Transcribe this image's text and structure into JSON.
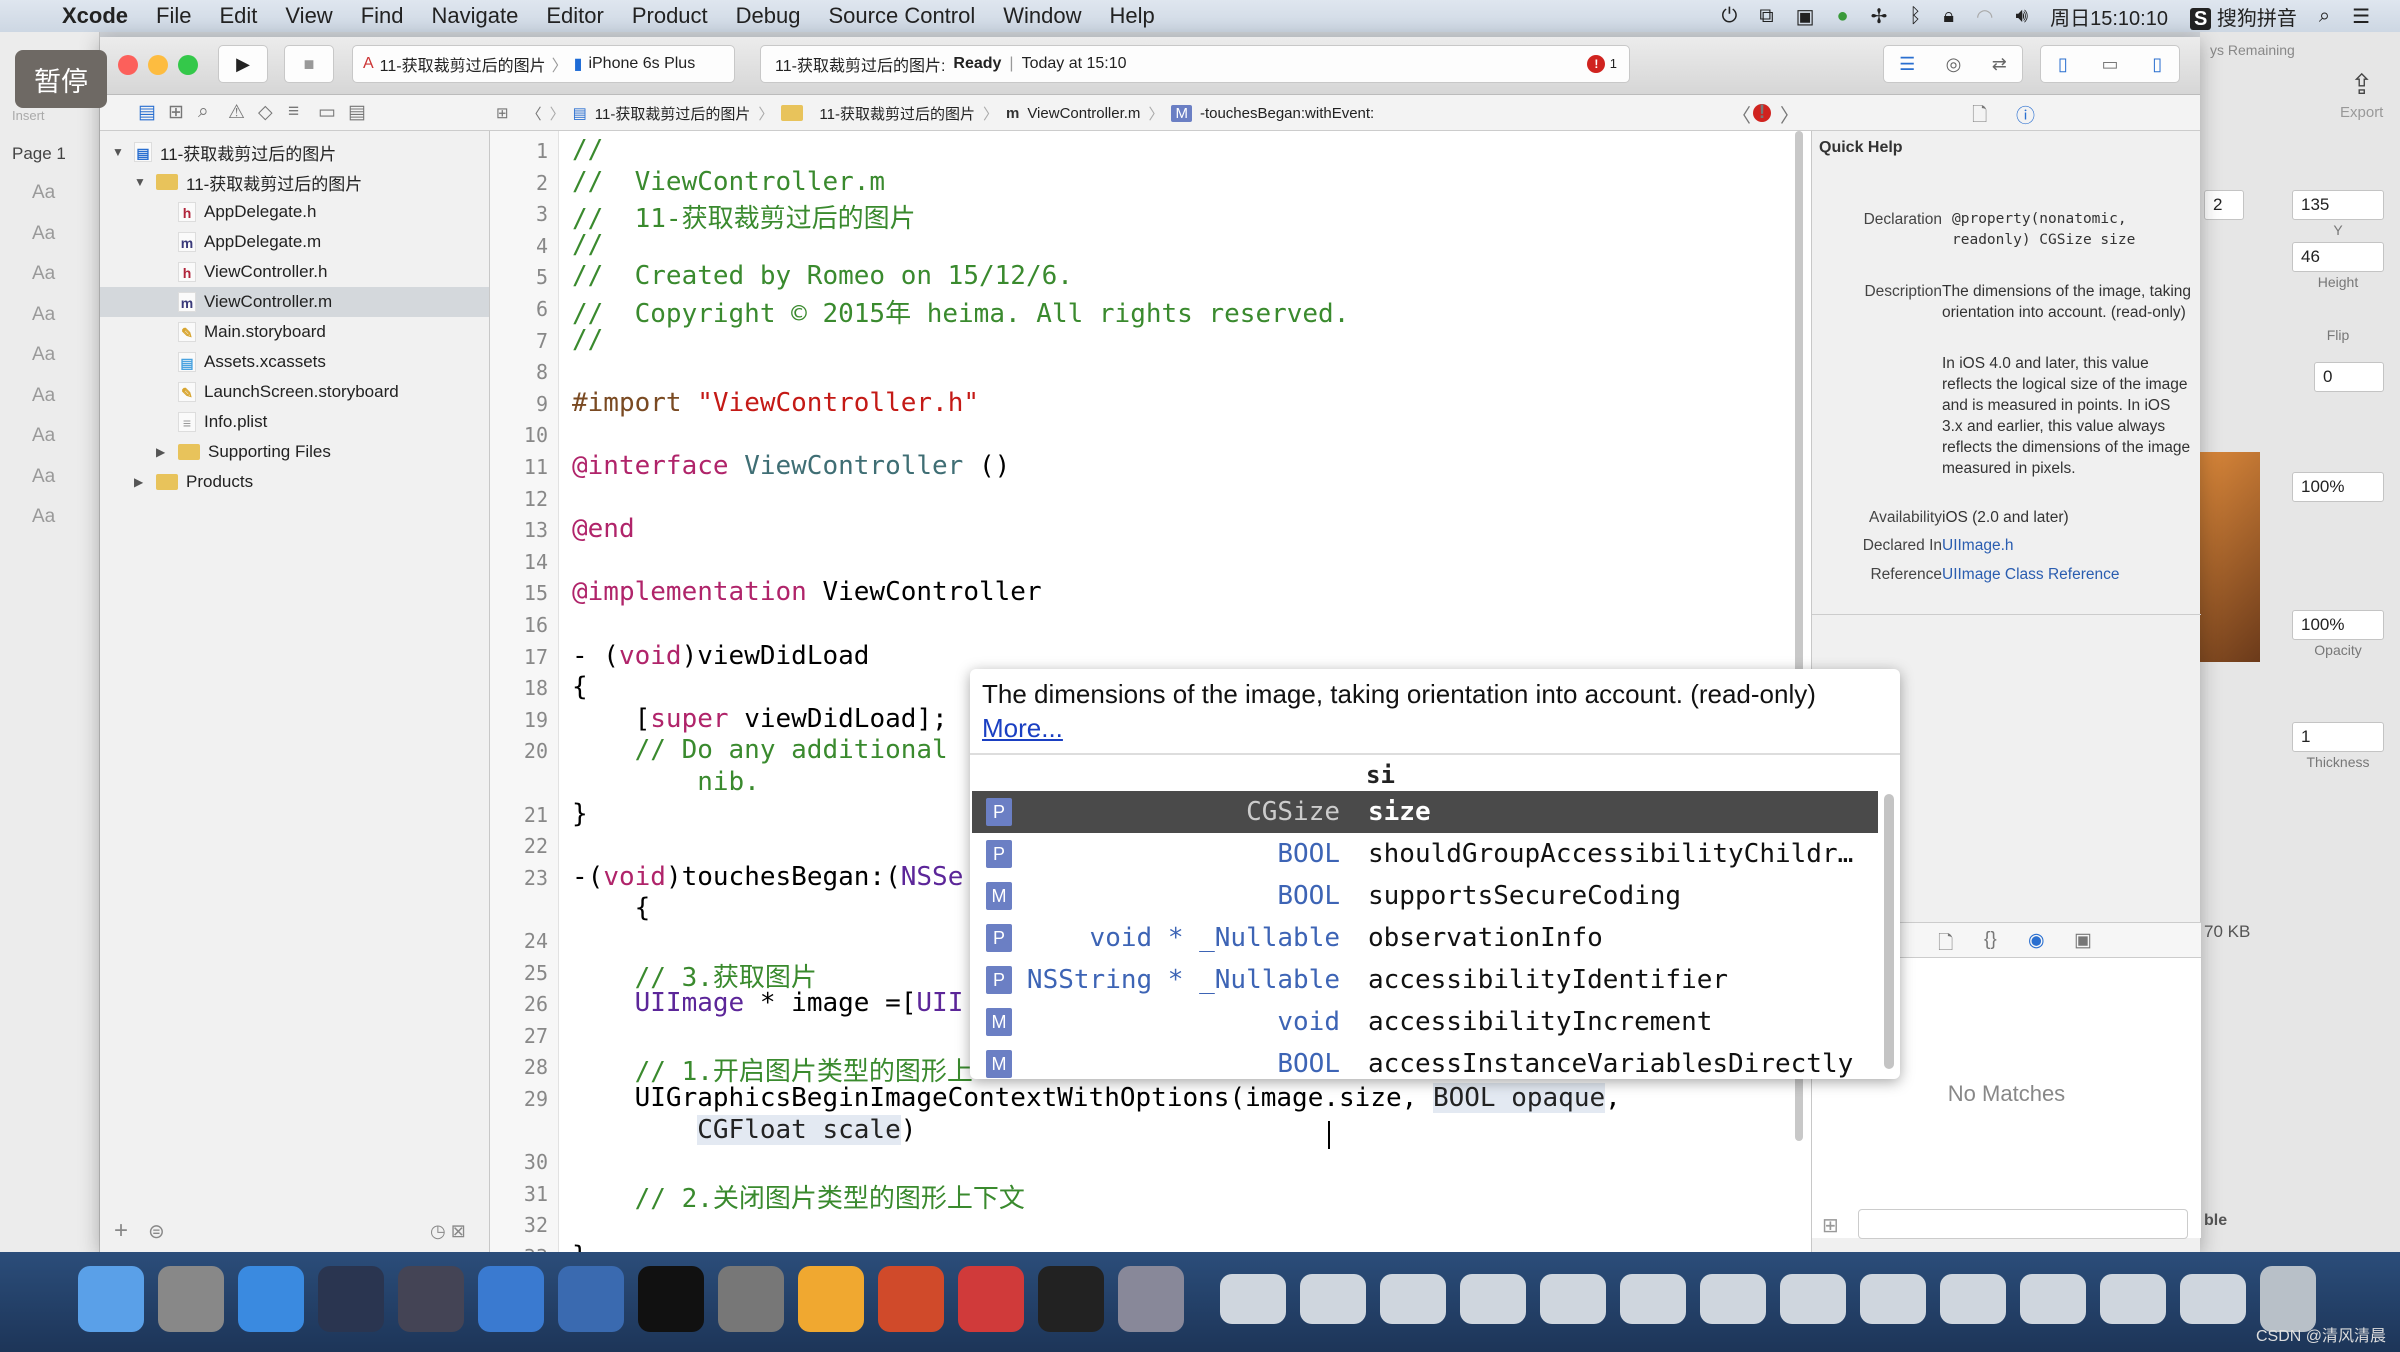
{
  "menubar": {
    "app": "Xcode",
    "items": [
      "File",
      "Edit",
      "View",
      "Find",
      "Navigate",
      "Editor",
      "Product",
      "Debug",
      "Source Control",
      "Window",
      "Help"
    ],
    "clock": "周日15:10:10",
    "ime": "搜狗拼音"
  },
  "overlay": {
    "pause": "暂停"
  },
  "toolbar": {
    "scheme": "11-获取裁剪过后的图片",
    "device": "iPhone 6s Plus",
    "status_project": "11-获取裁剪过后的图片:",
    "status_state": "Ready",
    "status_time": "Today at 15:10",
    "error_count": "1"
  },
  "jumpbar": [
    "11-获取裁剪过后的图片",
    "11-获取裁剪过后的图片",
    "ViewController.m",
    "-touchesBegan:withEvent:"
  ],
  "navigator": {
    "items": [
      {
        "label": "11-获取裁剪过后的图片",
        "icon": "project",
        "level": 0,
        "disc": "▼"
      },
      {
        "label": "11-获取裁剪过后的图片",
        "icon": "folder",
        "level": 1,
        "disc": "▼"
      },
      {
        "label": "AppDelegate.h",
        "icon": "h",
        "level": 2
      },
      {
        "label": "AppDelegate.m",
        "icon": "m",
        "level": 2
      },
      {
        "label": "ViewController.h",
        "icon": "h",
        "level": 2
      },
      {
        "label": "ViewController.m",
        "icon": "m",
        "level": 2,
        "selected": true
      },
      {
        "label": "Main.storyboard",
        "icon": "storyboard",
        "level": 2
      },
      {
        "label": "Assets.xcassets",
        "icon": "assets",
        "level": 2
      },
      {
        "label": "LaunchScreen.storyboard",
        "icon": "storyboard",
        "level": 2
      },
      {
        "label": "Info.plist",
        "icon": "plist",
        "level": 2
      },
      {
        "label": "Supporting Files",
        "icon": "folder",
        "level": 2,
        "disc": "▶"
      },
      {
        "label": "Products",
        "icon": "folder",
        "level": 1,
        "disc": "▶"
      }
    ]
  },
  "code": [
    {
      "n": "1",
      "s": [
        [
          "//",
          "com"
        ]
      ]
    },
    {
      "n": "2",
      "s": [
        [
          "//  ViewController.m",
          "com"
        ]
      ]
    },
    {
      "n": "3",
      "s": [
        [
          "//  11-获取裁剪过后的图片",
          "com"
        ]
      ]
    },
    {
      "n": "4",
      "s": [
        [
          "//",
          "com"
        ]
      ]
    },
    {
      "n": "5",
      "s": [
        [
          "//  Created by Romeo on 15/12/6.",
          "com"
        ]
      ]
    },
    {
      "n": "6",
      "s": [
        [
          "//  Copyright © 2015年 heima. All rights reserved.",
          "com"
        ]
      ]
    },
    {
      "n": "7",
      "s": [
        [
          "//",
          "com"
        ]
      ]
    },
    {
      "n": "8",
      "s": []
    },
    {
      "n": "9",
      "s": [
        [
          "#import ",
          "pp"
        ],
        [
          "\"ViewController.h\"",
          "str"
        ]
      ]
    },
    {
      "n": "10",
      "s": []
    },
    {
      "n": "11",
      "s": [
        [
          "@interface ",
          "kw"
        ],
        [
          "ViewController",
          "cls"
        ],
        [
          " ()",
          ""
        ]
      ]
    },
    {
      "n": "12",
      "s": []
    },
    {
      "n": "13",
      "s": [
        [
          "@end",
          "kw"
        ]
      ]
    },
    {
      "n": "14",
      "s": []
    },
    {
      "n": "15",
      "s": [
        [
          "@implementation ",
          "kw"
        ],
        [
          "ViewController",
          ""
        ]
      ]
    },
    {
      "n": "16",
      "s": []
    },
    {
      "n": "17",
      "s": [
        [
          "- (",
          ""
        ],
        [
          "void",
          "kw"
        ],
        [
          ")viewDidLoad",
          ""
        ]
      ]
    },
    {
      "n": "18",
      "s": [
        [
          "{",
          ""
        ]
      ]
    },
    {
      "n": "19",
      "s": [
        [
          "    [",
          ""
        ],
        [
          "super",
          "kw"
        ],
        [
          " viewDidLoad];",
          ""
        ]
      ]
    },
    {
      "n": "20",
      "s": [
        [
          "    // Do any additional",
          "com"
        ]
      ]
    },
    {
      "n": "",
      "s": [
        [
          "        nib.",
          "com"
        ]
      ]
    },
    {
      "n": "21",
      "s": [
        [
          "}",
          ""
        ]
      ]
    },
    {
      "n": "22",
      "s": []
    },
    {
      "n": "23",
      "s": [
        [
          "-(",
          ""
        ],
        [
          "void",
          "kw"
        ],
        [
          ")touchesBegan:(",
          ""
        ],
        [
          "NSSe",
          "type"
        ]
      ]
    },
    {
      "n": "",
      "s": [
        [
          "    {",
          ""
        ]
      ]
    },
    {
      "n": "24",
      "s": []
    },
    {
      "n": "25",
      "s": [
        [
          "    // 3.获取图片",
          "com"
        ]
      ]
    },
    {
      "n": "26",
      "s": [
        [
          "    ",
          ""
        ],
        [
          "UIImage",
          "type"
        ],
        [
          " * image =[",
          ""
        ],
        [
          "UII",
          "type"
        ]
      ]
    },
    {
      "n": "27",
      "s": []
    },
    {
      "n": "28",
      "s": [
        [
          "    // 1.开启图片类型的图形上",
          "com"
        ]
      ]
    },
    {
      "n": "29",
      "s": [
        [
          "    UIGraphicsBeginImageContextWithOptions(image.size, ",
          ""
        ],
        [
          "BOOL opaque",
          "ph"
        ],
        [
          ",",
          ""
        ]
      ]
    },
    {
      "n": "",
      "s": [
        [
          "        ",
          ""
        ],
        [
          "CGFloat scale",
          "ph"
        ],
        [
          ")",
          ""
        ]
      ]
    },
    {
      "n": "30",
      "s": []
    },
    {
      "n": "31",
      "s": [
        [
          "    // 2.关闭图片类型的图形上下文",
          "com"
        ]
      ]
    },
    {
      "n": "32",
      "s": []
    },
    {
      "n": "33",
      "s": [
        [
          "}",
          ""
        ]
      ]
    }
  ],
  "completion": {
    "description": "The dimensions of the image, taking orientation into account. (read-only)",
    "more": "More...",
    "typed": "si",
    "items": [
      {
        "kind": "P",
        "type": "CGSize",
        "name": "size"
      },
      {
        "kind": "P",
        "type": "BOOL",
        "name": "shouldGroupAccessibilityChildr…"
      },
      {
        "kind": "M",
        "type": "BOOL",
        "name": "supportsSecureCoding"
      },
      {
        "kind": "P",
        "type": "void * _Nullable",
        "name": "observationInfo"
      },
      {
        "kind": "P",
        "type": "NSString * _Nullable",
        "name": "accessibilityIdentifier"
      },
      {
        "kind": "M",
        "type": "void",
        "name": "accessibilityIncrement"
      },
      {
        "kind": "M",
        "type": "BOOL",
        "name": "accessInstanceVariablesDirectly"
      }
    ]
  },
  "quick_help": {
    "title": "Quick Help",
    "declaration_label": "Declaration",
    "declaration": "@property(nonatomic, readonly) CGSize size",
    "description_label": "Description",
    "description": "The dimensions of the image, taking orientation into account. (read-only)",
    "description2": "In iOS 4.0 and later, this value reflects the logical size of the image and is measured in points. In iOS 3.x and earlier, this value always reflects the dimensions of the image measured in pixels.",
    "availability_label": "Availability",
    "availability": "iOS (2.0 and later)",
    "declared_label": "Declared In",
    "declared": "UIImage.h",
    "reference_label": "Reference",
    "reference": "UIImage Class Reference"
  },
  "library": {
    "empty": "No Matches"
  },
  "background_app": {
    "remaining": "ys Remaining",
    "export": "Export",
    "insert": "Insert",
    "page": "Page 1",
    "aa": "Aa",
    "y_value": "135",
    "y_label": "Y",
    "height_value": "46",
    "height_label": "Height",
    "flip_label": "Flip",
    "rotation": "0",
    "opacity1": "100%",
    "opacity2": "100%",
    "opacity_label": "Opacity",
    "thickness": "1",
    "thickness_label": "Thickness",
    "size": "70 KB",
    "table": "ble",
    "partial_x": "2"
  },
  "watermark": "CSDN @清风清晨",
  "colors": {
    "accent": "#2a5db0",
    "comment": "#3a8a2e",
    "keyword": "#b0246a",
    "string": "#c41a16",
    "selection": "#4a4a4a"
  }
}
